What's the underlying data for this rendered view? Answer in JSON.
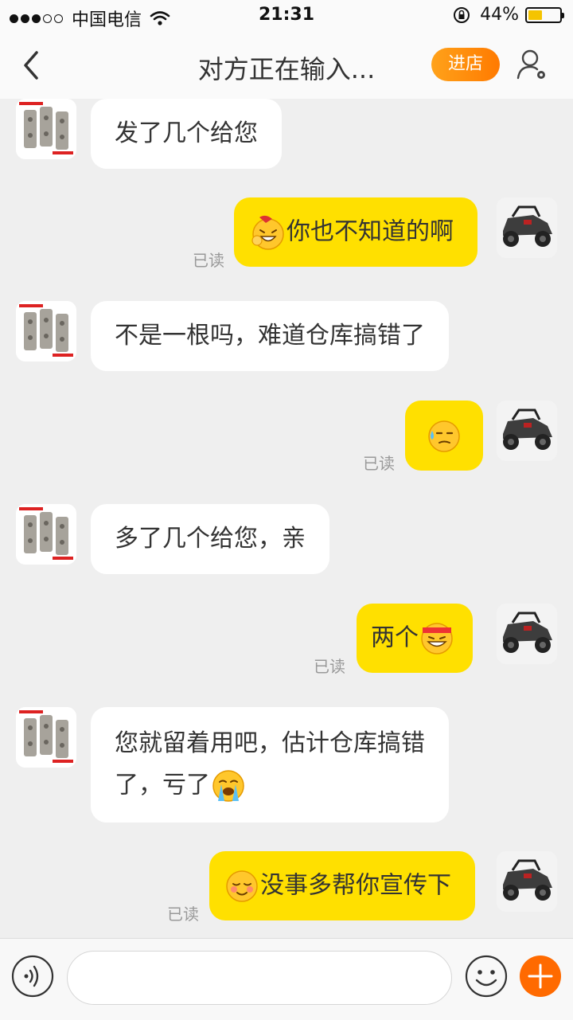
{
  "status_bar": {
    "carrier": "中国电信",
    "time": "21:31",
    "battery": "44%",
    "battery_level": 0.44
  },
  "header": {
    "title": "对方正在输入...",
    "shop_button": "进店",
    "icons": {
      "back": "back-chevron-icon",
      "profile": "user-settings-icon"
    }
  },
  "messages": [
    {
      "side": "in",
      "text": "发了几个给您"
    },
    {
      "side": "out",
      "emoji_before": "cover-mouth-laugh-emoji",
      "text": "你也不知道的啊",
      "read": "已读"
    },
    {
      "side": "in",
      "text": "不是一根吗，难道仓库搞错了"
    },
    {
      "side": "out",
      "emoji_only": "sweat-emoji",
      "read": "已读"
    },
    {
      "side": "in",
      "text": "多了几个给您，亲"
    },
    {
      "side": "out",
      "text": "两个",
      "emoji_after": "grin-headband-emoji",
      "read": "已读"
    },
    {
      "side": "in",
      "line1": "您就留着用吧，估计仓库搞错",
      "line2": "了，亏了",
      "emoji_after": "crying-emoji"
    },
    {
      "side": "out",
      "emoji_before": "blush-smile-emoji",
      "text": "没事多帮你宣传下",
      "read": "已读"
    }
  ],
  "input_bar": {
    "placeholder": "",
    "icons": {
      "voice": "voice-icon",
      "emoji": "emoji-icon",
      "plus": "plus-icon"
    }
  },
  "colors": {
    "outgoing_bubble": "#ffe000",
    "incoming_bubble": "#ffffff",
    "accent": "#ff7a00",
    "background": "#efefef"
  }
}
